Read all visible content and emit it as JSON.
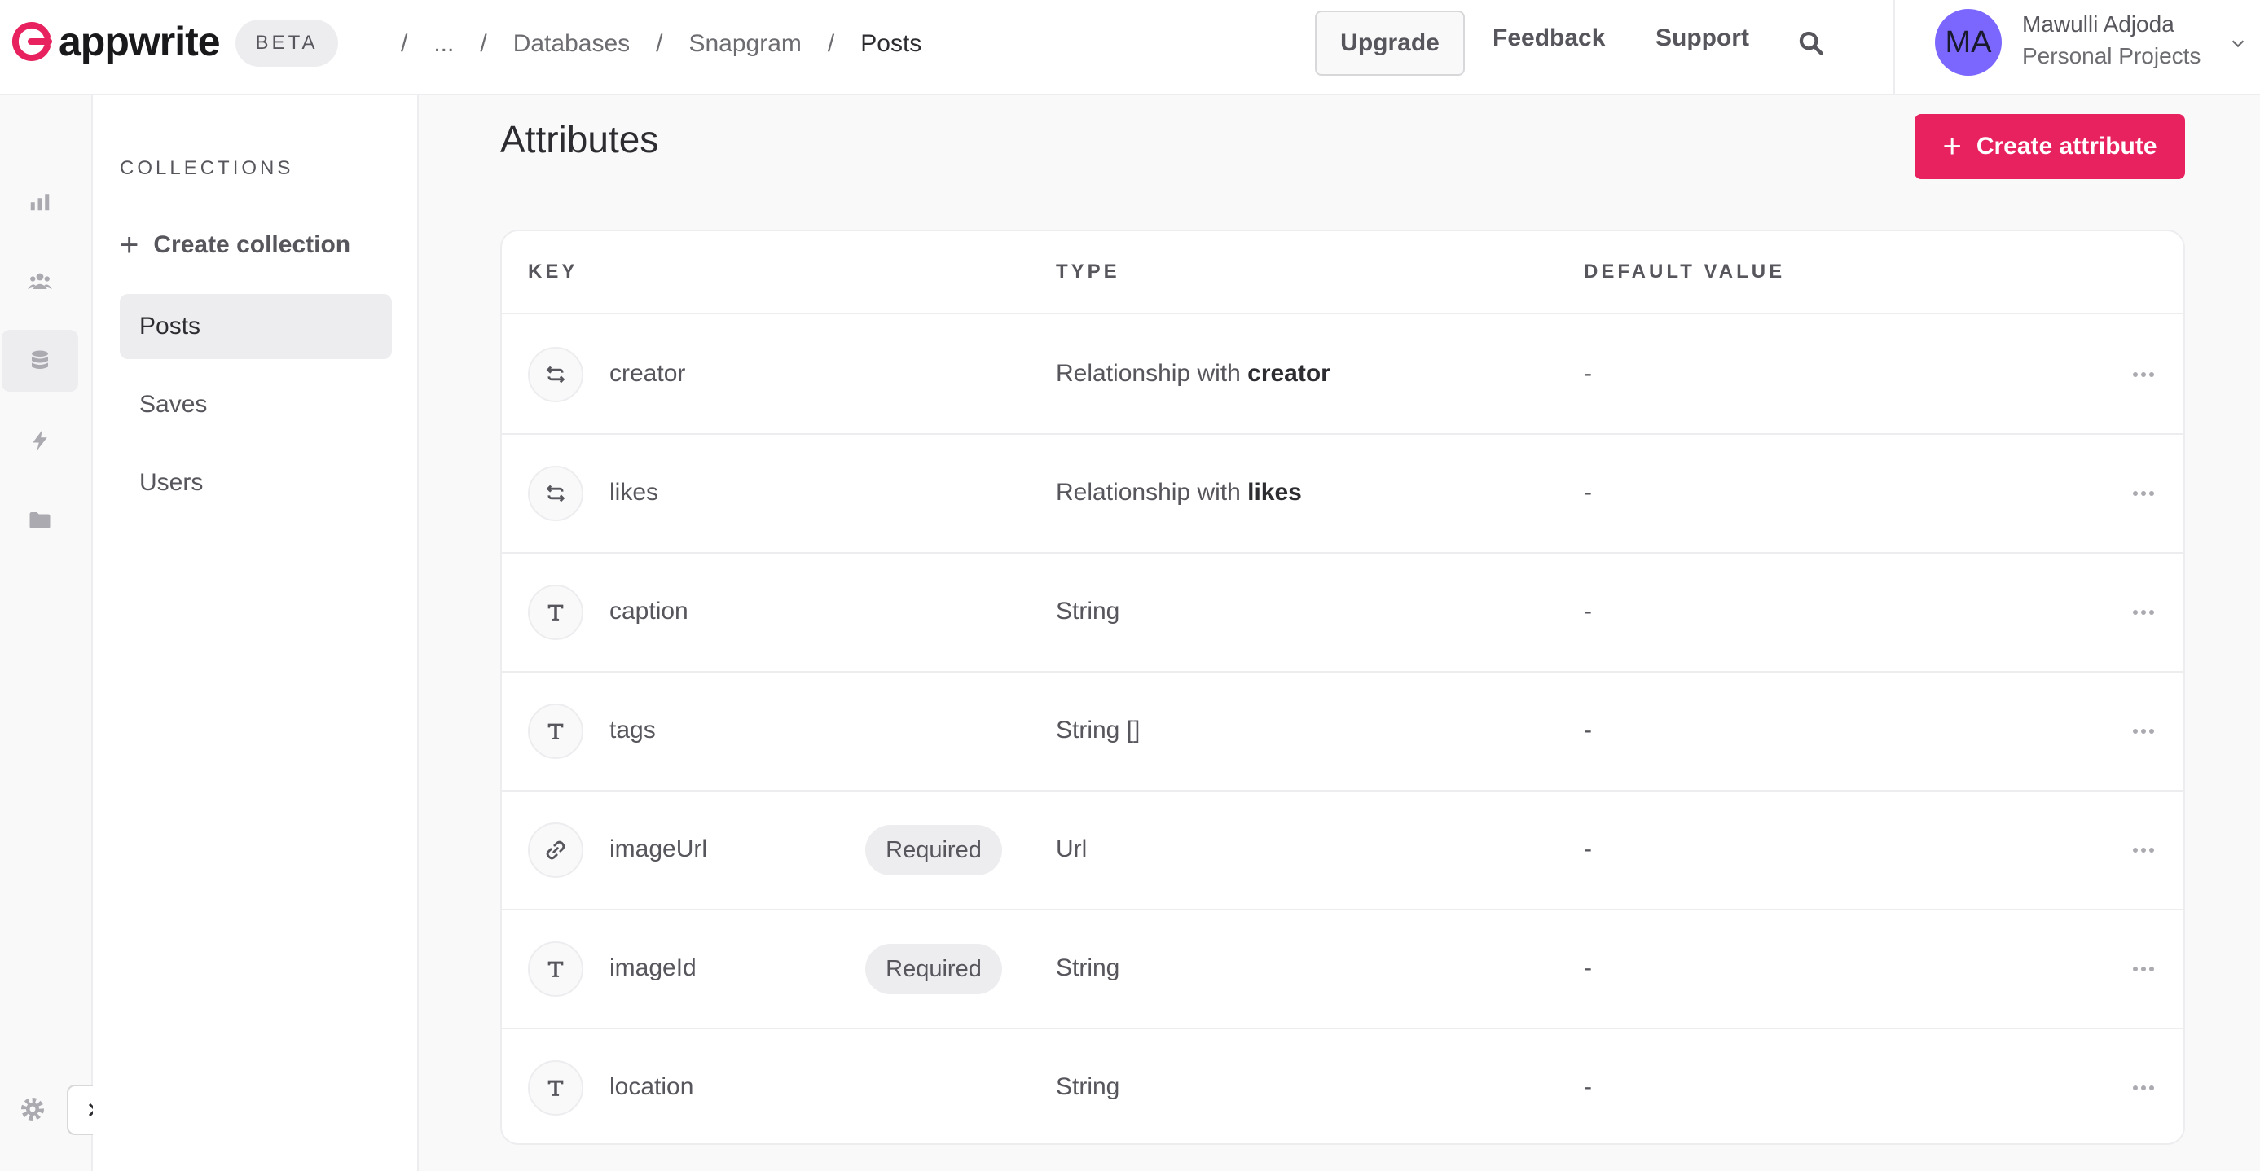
{
  "header": {
    "logo_text": "appwrite",
    "badge": "BETA",
    "breadcrumb": [
      "...",
      "Databases",
      "Snapgram",
      "Posts"
    ],
    "upgrade_label": "Upgrade",
    "feedback_label": "Feedback",
    "support_label": "Support",
    "user": {
      "initials": "MA",
      "name": "Mawulli Adjoda",
      "org": "Personal Projects"
    }
  },
  "rail": {
    "icons": [
      "overview-icon",
      "auth-icon",
      "databases-icon",
      "functions-icon",
      "storage-icon"
    ],
    "active": "databases-icon"
  },
  "collections": {
    "heading": "COLLECTIONS",
    "create_label": "Create collection",
    "items": [
      "Posts",
      "Saves",
      "Users"
    ],
    "active": "Posts"
  },
  "main": {
    "title": "Attributes",
    "create_button": "Create attribute",
    "columns": [
      "KEY",
      "TYPE",
      "DEFAULT VALUE"
    ],
    "rows": [
      {
        "icon": "relationship-icon",
        "key": "creator",
        "required": "",
        "type_prefix": "Relationship with",
        "type_strong": "creator",
        "default": "-"
      },
      {
        "icon": "relationship-icon",
        "key": "likes",
        "required": "",
        "type_prefix": "Relationship with",
        "type_strong": "likes",
        "default": "-"
      },
      {
        "icon": "text-icon",
        "key": "caption",
        "required": "",
        "type_prefix": "String",
        "type_strong": "",
        "default": "-"
      },
      {
        "icon": "text-icon",
        "key": "tags",
        "required": "",
        "type_prefix": "String []",
        "type_strong": "",
        "default": "-"
      },
      {
        "icon": "link-icon",
        "key": "imageUrl",
        "required": "Required",
        "type_prefix": "Url",
        "type_strong": "",
        "default": "-"
      },
      {
        "icon": "text-icon",
        "key": "imageId",
        "required": "Required",
        "type_prefix": "String",
        "type_strong": "",
        "default": "-"
      },
      {
        "icon": "text-icon",
        "key": "location",
        "required": "",
        "type_prefix": "String",
        "type_strong": "",
        "default": "-"
      }
    ]
  },
  "colors": {
    "brand": "#e7225f",
    "avatar": "#7c67fe"
  }
}
